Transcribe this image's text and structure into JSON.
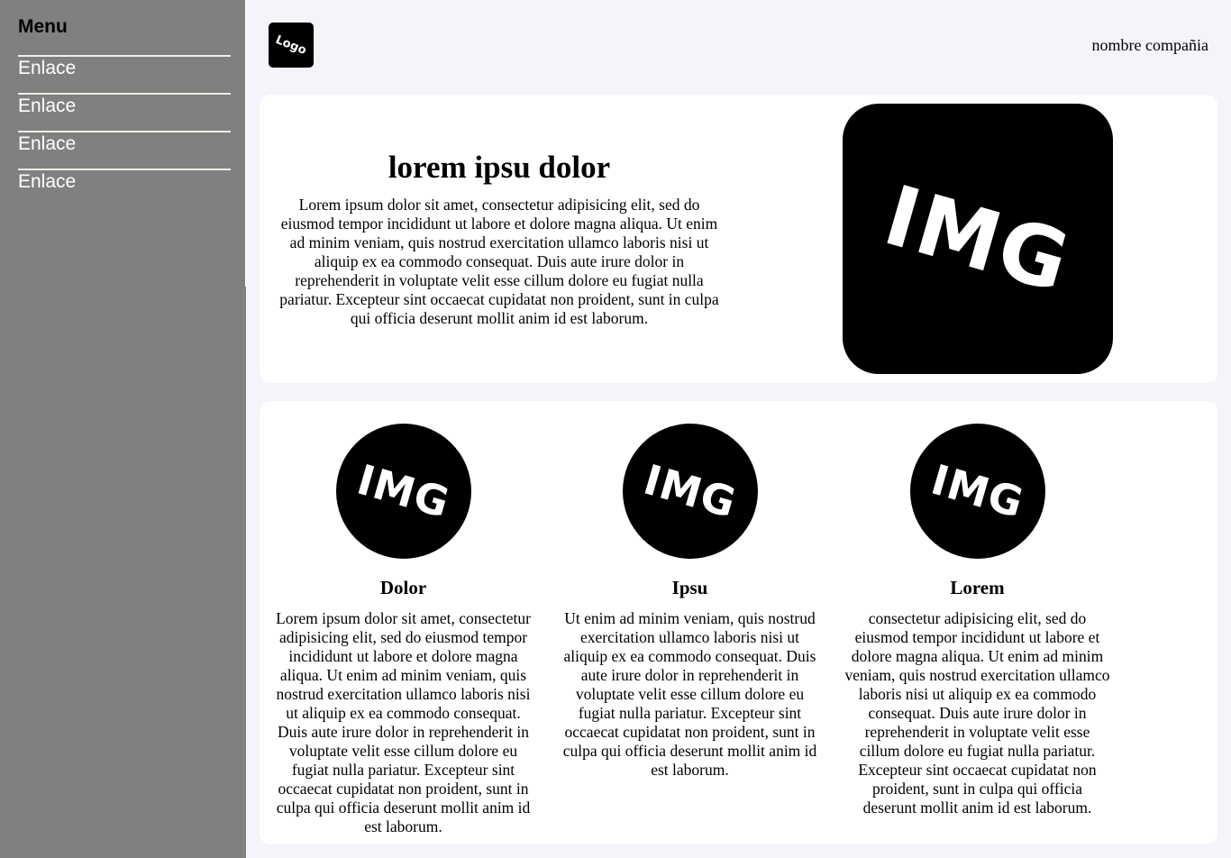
{
  "sidebar": {
    "title": "Menu",
    "items": [
      {
        "label": "Enlace"
      },
      {
        "label": "Enlace"
      },
      {
        "label": "Enlace"
      },
      {
        "label": "Enlace"
      }
    ]
  },
  "header": {
    "logo_text": "Logo",
    "company_name": "nombre compañia"
  },
  "hero": {
    "title": "lorem ipsu dolor",
    "body": "Lorem ipsum dolor sit amet, consectetur adipisicing elit, sed do eiusmod tempor incididunt ut labore et dolore magna aliqua. Ut enim ad minim veniam, quis nostrud exercitation ullamco laboris nisi ut aliquip ex ea commodo consequat. Duis aute irure dolor in reprehenderit in voluptate velit esse cillum dolore eu fugiat nulla pariatur. Excepteur sint occaecat cupidatat non proident, sunt in culpa qui officia deserunt mollit anim id est laborum.",
    "image_label": "IMG"
  },
  "features": [
    {
      "image_label": "IMG",
      "title": "Dolor",
      "body": "Lorem ipsum dolor sit amet, consectetur adipisicing elit, sed do eiusmod tempor incididunt ut labore et dolore magna aliqua. Ut enim ad minim veniam, quis nostrud exercitation ullamco laboris nisi ut aliquip ex ea commodo consequat. Duis aute irure dolor in reprehenderit in voluptate velit esse cillum dolore eu fugiat nulla pariatur. Excepteur sint occaecat cupidatat non proident, sunt in culpa qui officia deserunt mollit anim id est laborum."
    },
    {
      "image_label": "IMG",
      "title": "Ipsu",
      "body": "Ut enim ad minim veniam, quis nostrud exercitation ullamco laboris nisi ut aliquip ex ea commodo consequat. Duis aute irure dolor in reprehenderit in voluptate velit esse cillum dolore eu fugiat nulla pariatur. Excepteur sint occaecat cupidatat non proident, sunt in culpa qui officia deserunt mollit anim id est laborum."
    },
    {
      "image_label": "IMG",
      "title": "Lorem",
      "body": "consectetur adipisicing elit, sed do eiusmod tempor incididunt ut labore et dolore magna aliqua. Ut enim ad minim veniam, quis nostrud exercitation ullamco laboris nisi ut aliquip ex ea commodo consequat. Duis aute irure dolor in reprehenderit in voluptate velit esse cillum dolore eu fugiat nulla pariatur. Excepteur sint occaecat cupidatat non proident, sunt in culpa qui officia deserunt mollit anim id est laborum."
    }
  ],
  "colors": {
    "sidebar_bg": "#808080",
    "page_bg": "#f4f5fa",
    "card_bg": "#ffffff",
    "image_bg": "#000000"
  }
}
